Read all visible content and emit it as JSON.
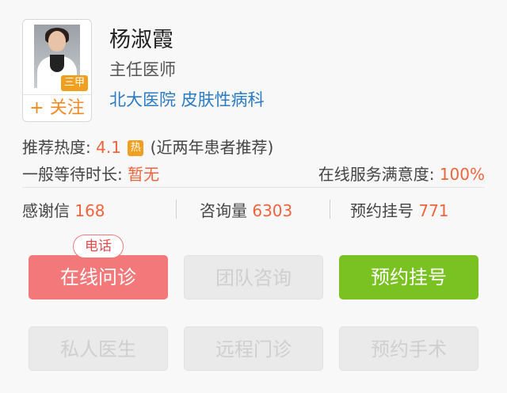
{
  "doctor": {
    "name": "杨淑霞",
    "title": "主任医师",
    "hospital": "北大医院 皮肤性病科",
    "level_badge": "三甲",
    "follow_label": "+ 关注",
    "avatar_icon": "doctor-photo"
  },
  "recommend": {
    "label": "推荐热度: ",
    "score": "4.1",
    "hot_badge": "热",
    "note": " (近两年患者推荐)"
  },
  "wait": {
    "label": "一般等待时长: ",
    "value": "暂无"
  },
  "satisfaction": {
    "label": "在线服务满意度: ",
    "value": "100%"
  },
  "stats": [
    {
      "label": "感谢信 ",
      "value": "168"
    },
    {
      "label": "咨询量 ",
      "value": "6303"
    },
    {
      "label": "预约挂号 ",
      "value": "771"
    }
  ],
  "services": {
    "phone_tag": "电话",
    "row1": [
      "在线问诊",
      "团队咨询",
      "预约挂号"
    ],
    "row2": [
      "私人医生",
      "远程门诊",
      "预约手术"
    ]
  },
  "colors": {
    "accent_orange": "#f0643c",
    "link_blue": "#2a7bc4",
    "online_consult_red": "#f2787a",
    "appointment_green": "#7ac222",
    "disabled_grey": "#eaeaea"
  }
}
